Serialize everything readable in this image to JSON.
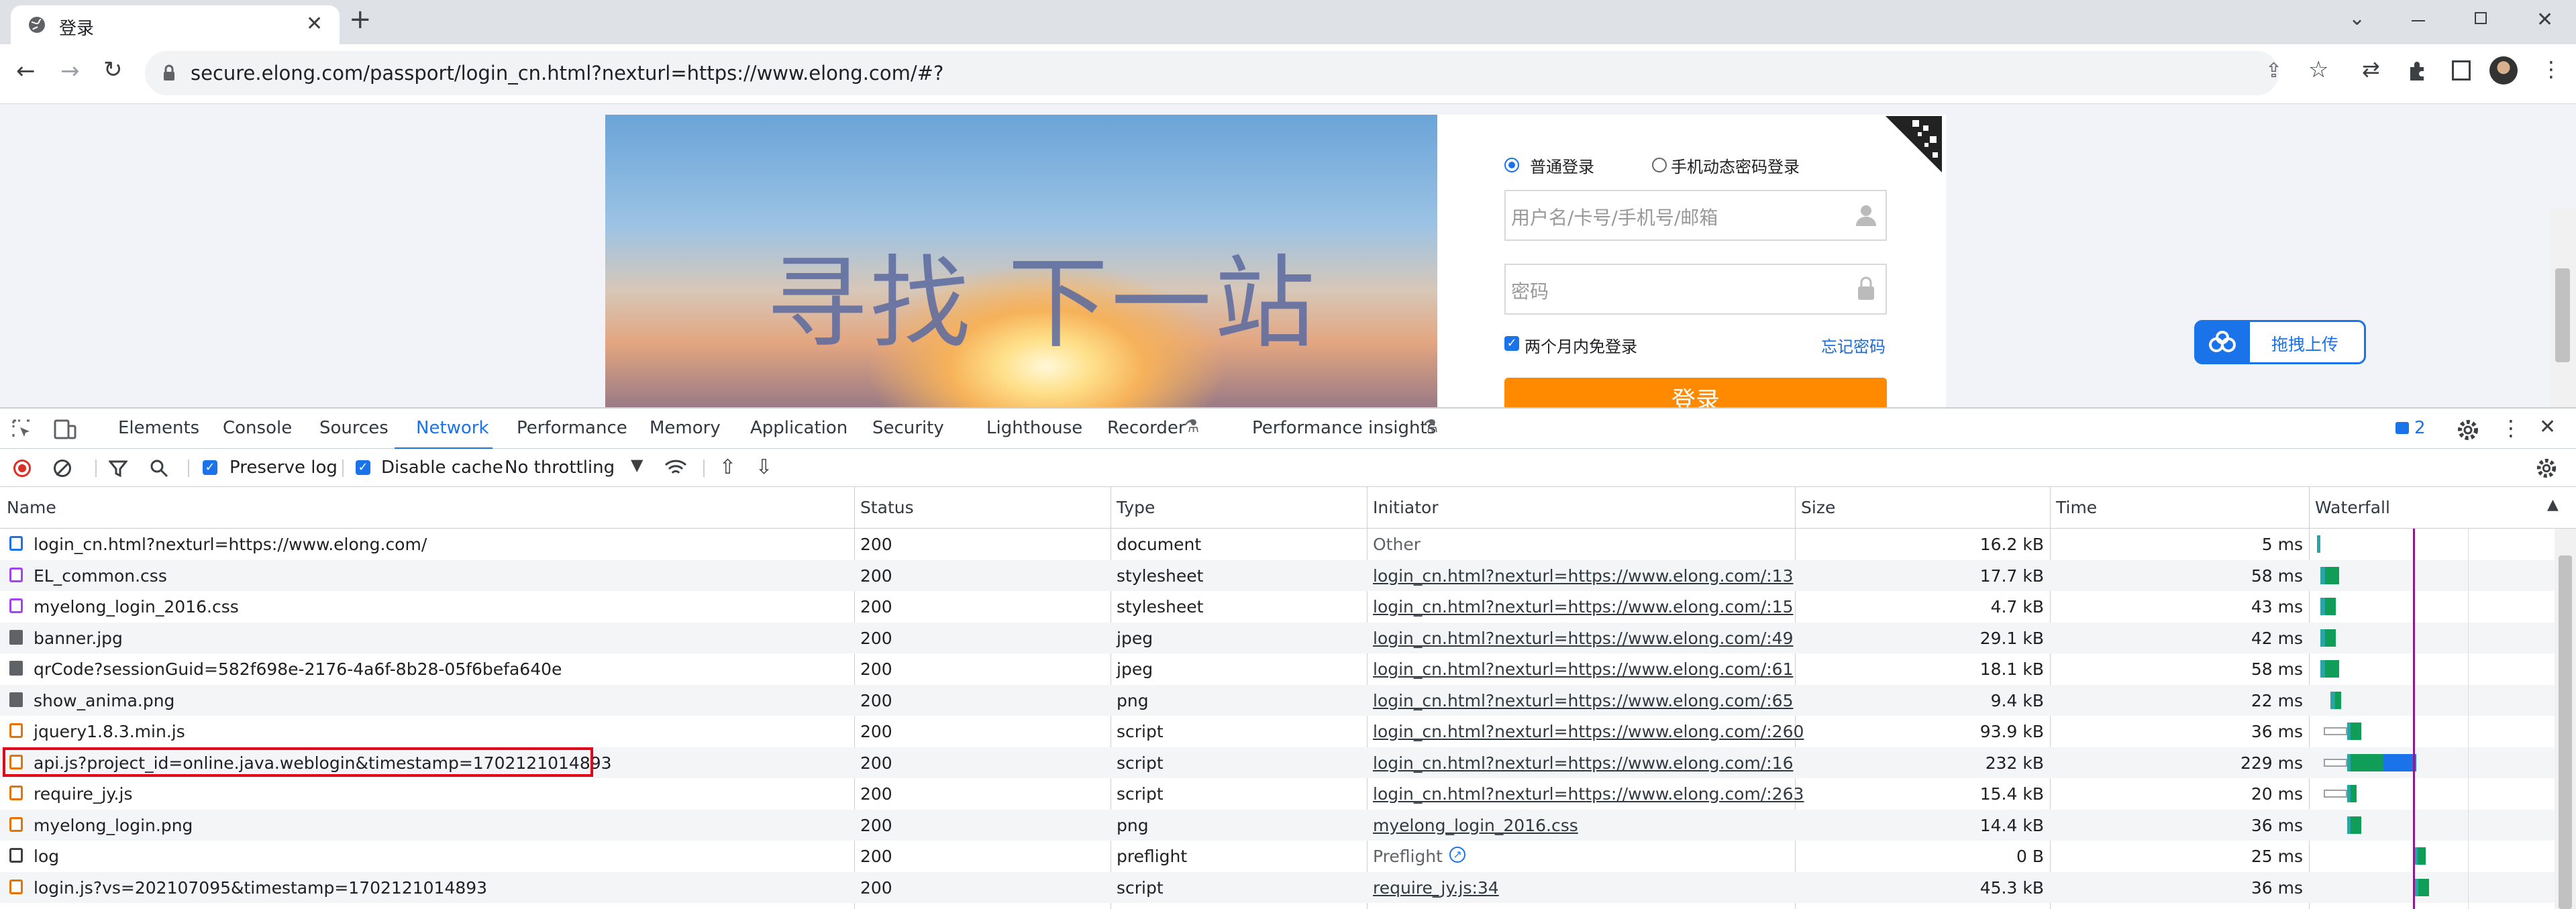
{
  "browser": {
    "tab_title": "登录",
    "new_tab": "+",
    "url": "secure.elong.com/passport/login_cn.html?nexturl=https://www.elong.com/#?"
  },
  "page": {
    "slogan": "寻找 下一站",
    "login_mode_normal": "普通登录",
    "login_mode_sms": "手机动态密码登录",
    "username_placeholder": "用户名/卡号/手机号/邮箱",
    "password_placeholder": "密码",
    "remember": "两个月内免登录",
    "forgot": "忘记密码",
    "login_button": "登录",
    "upload_button": "拖拽上传"
  },
  "devtools": {
    "tabs": [
      "Elements",
      "Console",
      "Sources",
      "Network",
      "Performance",
      "Memory",
      "Application",
      "Security",
      "Lighthouse",
      "Recorder",
      "Performance insights"
    ],
    "active_tab": "Network",
    "issues_count": "2",
    "preserve_log": "Preserve log",
    "disable_cache": "Disable cache",
    "throttling": "No throttling",
    "columns": [
      "Name",
      "Status",
      "Type",
      "Initiator",
      "Size",
      "Time",
      "Waterfall"
    ],
    "rows": [
      {
        "name": "login_cn.html?nexturl=https://www.elong.com/",
        "status": "200",
        "type": "document",
        "initiator": "Other",
        "size": "16.2 kB",
        "time": "5 ms",
        "icon": "document",
        "link": false,
        "wf": [
          {
            "s": 0.003,
            "w": 0.014,
            "c": "#2aa5a5"
          }
        ]
      },
      {
        "name": "EL_common.css",
        "status": "200",
        "type": "stylesheet",
        "initiator": "login_cn.html?nexturl=https://www.elong.com/:13",
        "size": "17.7 kB",
        "time": "58 ms",
        "icon": "stylesheet",
        "link": true,
        "wf": [
          {
            "s": 0.018,
            "w": 0.02,
            "c": "#2aa5a5"
          },
          {
            "s": 0.038,
            "w": 0.06,
            "c": "#0f9d58"
          }
        ]
      },
      {
        "name": "myelong_login_2016.css",
        "status": "200",
        "type": "stylesheet",
        "initiator": "login_cn.html?nexturl=https://www.elong.com/:15",
        "size": "4.7 kB",
        "time": "43 ms",
        "icon": "stylesheet",
        "link": true,
        "wf": [
          {
            "s": 0.018,
            "w": 0.02,
            "c": "#2aa5a5"
          },
          {
            "s": 0.038,
            "w": 0.045,
            "c": "#0f9d58"
          }
        ]
      },
      {
        "name": "banner.jpg",
        "status": "200",
        "type": "jpeg",
        "initiator": "login_cn.html?nexturl=https://www.elong.com/:49",
        "size": "29.1 kB",
        "time": "42 ms",
        "icon": "image",
        "link": true,
        "wf": [
          {
            "s": 0.018,
            "w": 0.02,
            "c": "#2aa5a5"
          },
          {
            "s": 0.038,
            "w": 0.045,
            "c": "#0f9d58"
          }
        ]
      },
      {
        "name": "qrCode?sessionGuid=582f698e-2176-4a6f-8b28-05f6befa640e",
        "status": "200",
        "type": "jpeg",
        "initiator": "login_cn.html?nexturl=https://www.elong.com/:61",
        "size": "18.1 kB",
        "time": "58 ms",
        "icon": "image",
        "link": true,
        "wf": [
          {
            "s": 0.018,
            "w": 0.02,
            "c": "#2aa5a5"
          },
          {
            "s": 0.038,
            "w": 0.06,
            "c": "#0f9d58"
          }
        ]
      },
      {
        "name": "show_anima.png",
        "status": "200",
        "type": "png",
        "initiator": "login_cn.html?nexturl=https://www.elong.com/:65",
        "size": "9.4 kB",
        "time": "22 ms",
        "icon": "image",
        "link": true,
        "wf": [
          {
            "s": 0.06,
            "w": 0.02,
            "c": "#2aa5a5"
          },
          {
            "s": 0.08,
            "w": 0.025,
            "c": "#0f9d58"
          }
        ]
      },
      {
        "name": "jquery1.8.3.min.js",
        "status": "200",
        "type": "script",
        "initiator": "login_cn.html?nexturl=https://www.elong.com/:260",
        "size": "93.9 kB",
        "time": "36 ms",
        "icon": "script",
        "link": true,
        "wf": [
          {
            "s": 0.03,
            "w": 0.1,
            "c": "#ffffff"
          },
          {
            "s": 0.13,
            "w": 0.015,
            "c": "#2aa5a5"
          },
          {
            "s": 0.145,
            "w": 0.045,
            "c": "#0f9d58"
          }
        ]
      },
      {
        "name": "api.js?project_id=online.java.weblogin&timestamp=1702121014893",
        "status": "200",
        "type": "script",
        "initiator": "login_cn.html?nexturl=https://www.elong.com/:16",
        "size": "232 kB",
        "time": "229 ms",
        "icon": "script",
        "link": true,
        "wf": [
          {
            "s": 0.03,
            "w": 0.1,
            "c": "#ffffff"
          },
          {
            "s": 0.13,
            "w": 0.015,
            "c": "#2aa5a5"
          },
          {
            "s": 0.145,
            "w": 0.14,
            "c": "#0f9d58"
          },
          {
            "s": 0.285,
            "w": 0.14,
            "c": "#1a73e8"
          }
        ]
      },
      {
        "name": "require_jy.js",
        "status": "200",
        "type": "script",
        "initiator": "login_cn.html?nexturl=https://www.elong.com/:263",
        "size": "15.4 kB",
        "time": "20 ms",
        "icon": "script",
        "link": true,
        "wf": [
          {
            "s": 0.03,
            "w": 0.1,
            "c": "#ffffff"
          },
          {
            "s": 0.13,
            "w": 0.015,
            "c": "#2aa5a5"
          },
          {
            "s": 0.145,
            "w": 0.025,
            "c": "#0f9d58"
          }
        ]
      },
      {
        "name": "myelong_login.png",
        "status": "200",
        "type": "png",
        "initiator": "myelong_login_2016.css",
        "size": "14.4 kB",
        "time": "36 ms",
        "icon": "image-sprite",
        "link": true,
        "wf": [
          {
            "s": 0.13,
            "w": 0.015,
            "c": "#2aa5a5"
          },
          {
            "s": 0.145,
            "w": 0.045,
            "c": "#0f9d58"
          }
        ]
      },
      {
        "name": "log",
        "status": "200",
        "type": "preflight",
        "initiator": "Preflight",
        "size": "0 B",
        "time": "25 ms",
        "icon": "preflight",
        "link": false,
        "preflight_icon": true,
        "wf": [
          {
            "s": 0.42,
            "w": 0.01,
            "c": "#2aa5a5"
          },
          {
            "s": 0.43,
            "w": 0.035,
            "c": "#0f9d58"
          }
        ]
      },
      {
        "name": "login.js?vs=202107095&timestamp=1702121014893",
        "status": "200",
        "type": "script",
        "initiator": "require_jy.js:34",
        "size": "45.3 kB",
        "time": "36 ms",
        "icon": "script",
        "link": true,
        "wf": [
          {
            "s": 0.42,
            "w": 0.015,
            "c": "#2aa5a5"
          },
          {
            "s": 0.435,
            "w": 0.045,
            "c": "#0f9d58"
          }
        ]
      }
    ]
  },
  "colors": {
    "accent": "#1a73e8",
    "highlight": "#e0001a",
    "login_orange": "#ff8a00"
  }
}
